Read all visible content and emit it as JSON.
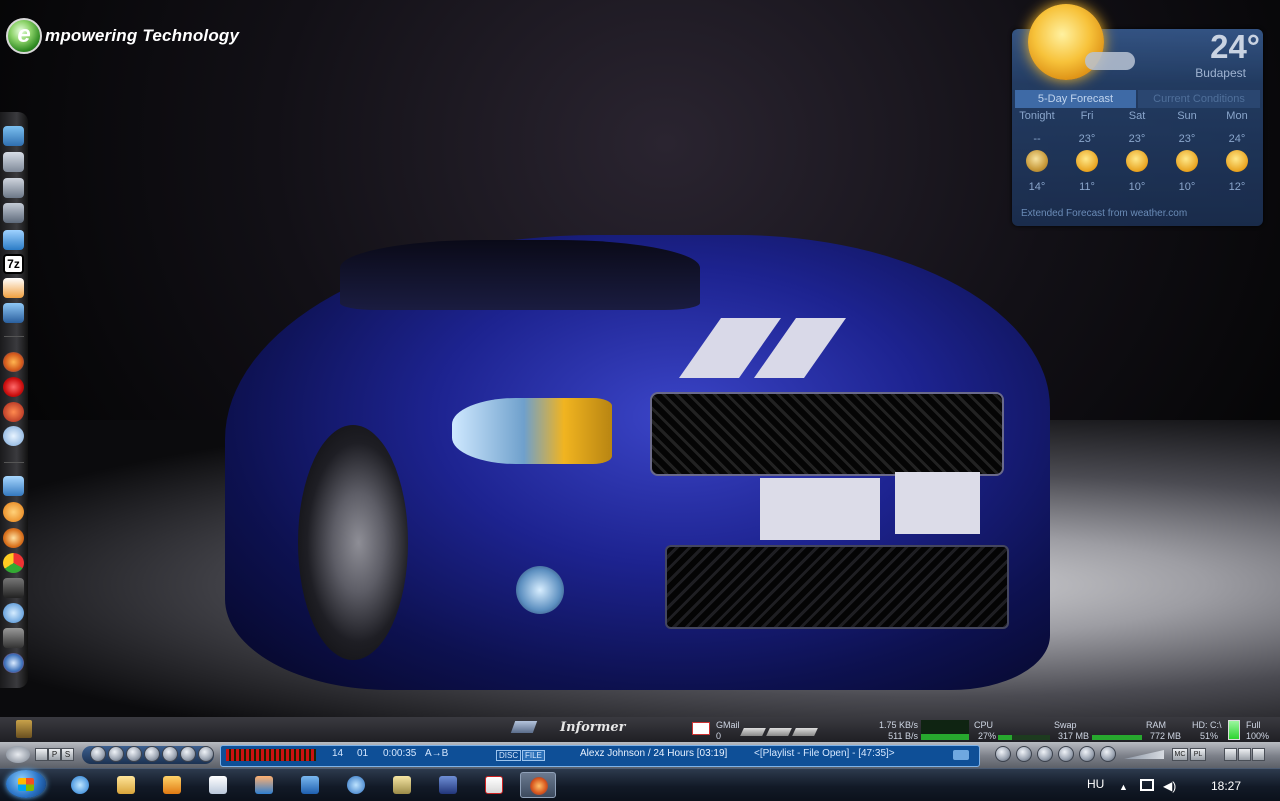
{
  "desktop": {
    "brand_letter": "e",
    "brand_text": "mpowering Technology"
  },
  "dock": {
    "items": [
      "pictures-icon",
      "documents-icon",
      "music-icon",
      "videos-icon",
      "computer-icon",
      "7zip-icon",
      "pen-icon",
      "network-icon",
      "firefox-icon",
      "opera-icon",
      "media-player-icon",
      "search-icon",
      "messenger-icon",
      "winamp-icon",
      "disc-burner-icon",
      "chrome-icon",
      "webcam-icon",
      "settings-icon",
      "tools-icon",
      "control-panel-icon"
    ],
    "seven_zip_label": "7z"
  },
  "weather": {
    "temperature": "24°",
    "city": "Budapest",
    "tabs": [
      "5-Day Forecast",
      "Current Conditions"
    ],
    "forecast": [
      {
        "day": "Tonight",
        "high": "--",
        "low": "14°"
      },
      {
        "day": "Fri",
        "high": "23°",
        "low": "11°"
      },
      {
        "day": "Sat",
        "high": "23°",
        "low": "10°"
      },
      {
        "day": "Sun",
        "high": "23°",
        "low": "10°"
      },
      {
        "day": "Mon",
        "high": "24°",
        "low": "12°"
      }
    ],
    "footer": "Extended Forecast from weather.com"
  },
  "infobar": {
    "informer": "Informer",
    "gmail_label": "GMail",
    "gmail_count": "0",
    "net_down": "1.75 KB/s",
    "net_up": "511 B/s",
    "cpu_label": "CPU",
    "cpu_value": "27%",
    "cpu_level": 0.27,
    "swap_label": "Swap",
    "swap_value": "317 MB",
    "ram_label": "RAM",
    "ram_value": "772 MB",
    "hd_label": "HD: C:\\",
    "hd_value": "51%",
    "battery_label": "Full",
    "battery_value": "100%"
  },
  "media": {
    "track_number": "14",
    "disc": "01",
    "elapsed": "0:00:35",
    "ab_label": "A→B",
    "disc_label": "DISC",
    "file_label": "FILE",
    "now_playing": "Alexz Johnson / 24 Hours  [03:19]",
    "playlist_status": "<[Playlist - File Open] - [47:35]>",
    "mode_buttons": [
      "P",
      "S"
    ],
    "right_buttons": [
      "MC",
      "PL"
    ]
  },
  "taskbar": {
    "apps": [
      "ie-icon",
      "explorer-icon",
      "media-player-icon",
      "notepad-icon",
      "network-icon",
      "store-icon",
      "messenger-icon",
      "pictures-icon",
      "save-icon",
      "mail-icon",
      "firefox-icon"
    ],
    "language": "HU",
    "clock": "18:27"
  },
  "colors": {
    "taskbar": "#121a27",
    "media_display": "#0e4f97",
    "weather_panel": "#26436e",
    "meter_green": "#27a82e"
  }
}
